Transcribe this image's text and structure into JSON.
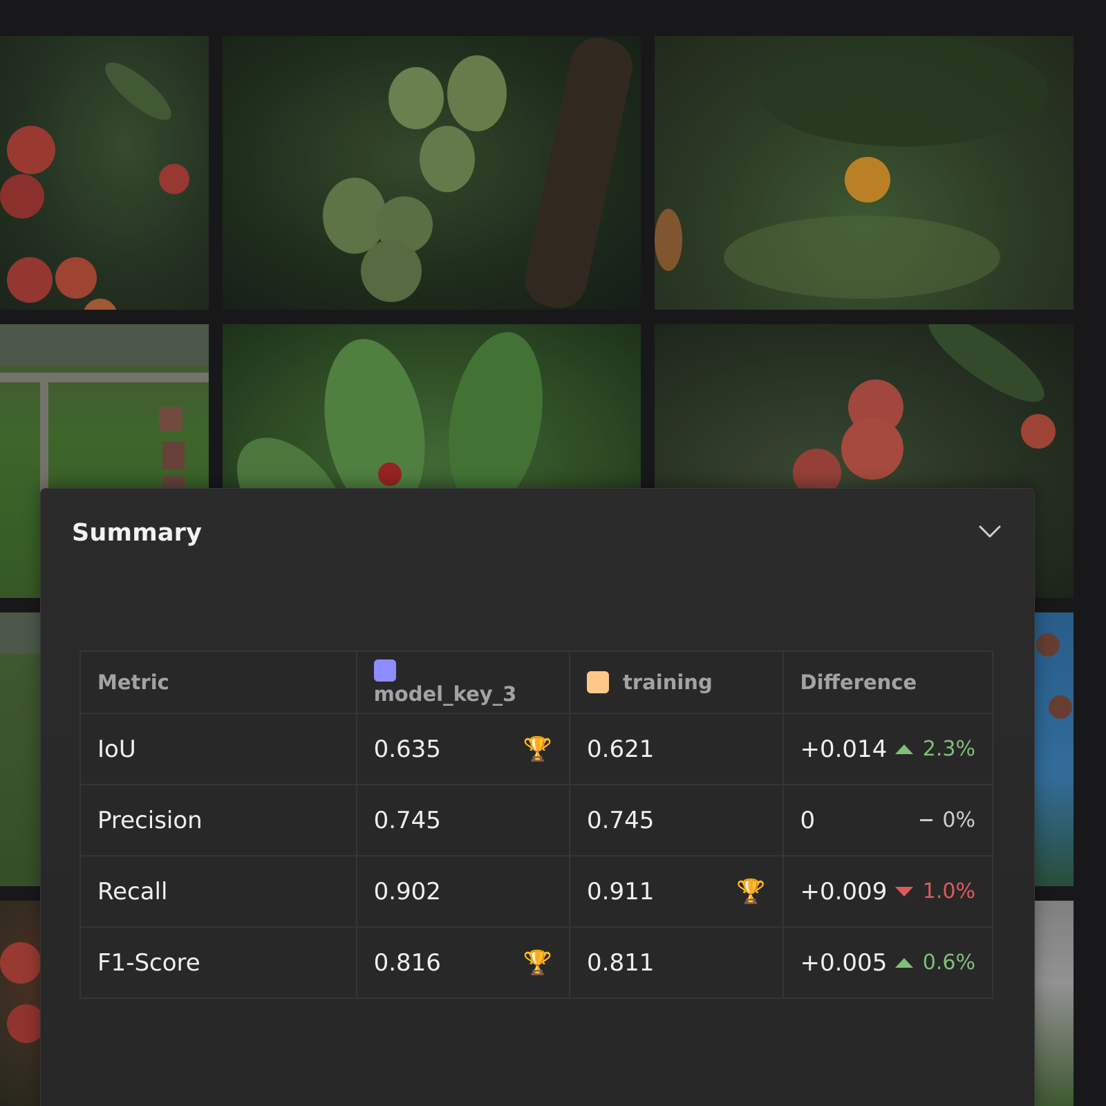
{
  "summary": {
    "title": "Summary",
    "collapse_icon": "chevron-down-icon"
  },
  "table": {
    "headers": {
      "metric": "Metric",
      "model_a": "model_key_3",
      "model_b": "training",
      "difference": "Difference"
    },
    "colors": {
      "model_a": "#8c8cff",
      "model_b": "#ffc88a",
      "up": "#7fbf7a",
      "down": "#e05a5a",
      "trophy": "#e0a21a"
    },
    "rows": [
      {
        "metric": "IoU",
        "a": "0.635",
        "b": "0.621",
        "diff": "+0.014",
        "delta": "2.3%",
        "trend": "up",
        "winner": "a"
      },
      {
        "metric": "Precision",
        "a": "0.745",
        "b": "0.745",
        "diff": "0",
        "delta": "0%",
        "trend": "flat",
        "winner": "none"
      },
      {
        "metric": "Recall",
        "a": "0.902",
        "b": "0.911",
        "diff": "+0.009",
        "delta": "1.0%",
        "trend": "down",
        "winner": "b"
      },
      {
        "metric": "F1-Score",
        "a": "0.816",
        "b": "0.811",
        "diff": "+0.005",
        "delta": "0.6%",
        "trend": "up",
        "winner": "a"
      }
    ]
  }
}
